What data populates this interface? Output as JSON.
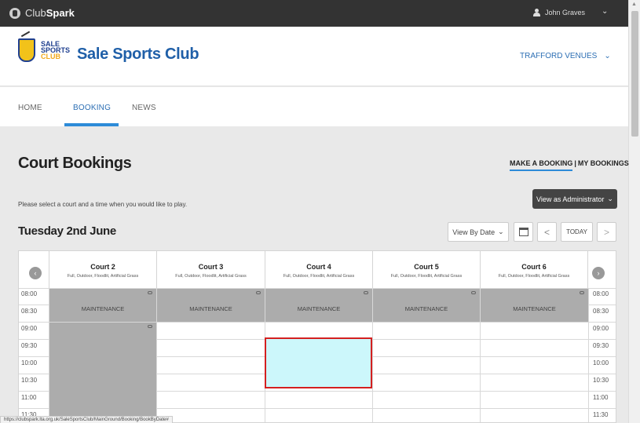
{
  "topbar": {
    "brand_prefix": "Club",
    "brand_bold": "Spark",
    "user_name": "John Graves",
    "caret": "⌄"
  },
  "club": {
    "wordmark_1": "SALE",
    "wordmark_2": "SPORTS",
    "wordmark_3": "CLUB",
    "name": "Sale Sports Club",
    "venues_label": "TRAFFORD VENUES",
    "venues_caret": "⌄"
  },
  "nav": {
    "home": "HOME",
    "booking": "BOOKING",
    "news": "NEWS"
  },
  "page": {
    "title": "Court Bookings",
    "make_booking": "MAKE A BOOKING",
    "separator": "|",
    "my_bookings": "MY BOOKINGS",
    "hint": "Please select a court and a time when you would like to play.",
    "admin_label": "View as Administrator",
    "admin_caret": "⌄",
    "date": "Tuesday 2nd June",
    "view_by": "View By Date",
    "view_by_caret": "⌄",
    "prev": "<",
    "today": "TODAY",
    "next": ">"
  },
  "grid": {
    "prev_icon": "‹",
    "next_icon": "›",
    "courts": [
      {
        "name": "Court 2",
        "desc": "Full, Outdoor, Floodlit, Artificial Grass"
      },
      {
        "name": "Court 3",
        "desc": "Full, Outdoor, Floodlit, Artificial Grass"
      },
      {
        "name": "Court 4",
        "desc": "Full, Outdoor, Floodlit, Artificial Grass"
      },
      {
        "name": "Court 5",
        "desc": "Full, Outdoor, Floodlit, Artificial Grass"
      },
      {
        "name": "Court 6",
        "desc": "Full, Outdoor, Floodlit, Artificial Grass"
      }
    ],
    "times": [
      "08:00",
      "08:30",
      "09:00",
      "09:30",
      "10:00",
      "10:30",
      "11:00",
      "11:30"
    ],
    "maintenance_label": "MAINTENANCE"
  },
  "status_url": "https://clubspark.lta.org.uk/SaleSportsClub/MainGround/Booking/BookByDate#",
  "colors": {
    "accent": "#2d8bd8",
    "club_blue": "#1f5fa8",
    "selection_border": "#d42020",
    "selection_fill": "#ccf7fb",
    "maintenance": "#acacac"
  }
}
